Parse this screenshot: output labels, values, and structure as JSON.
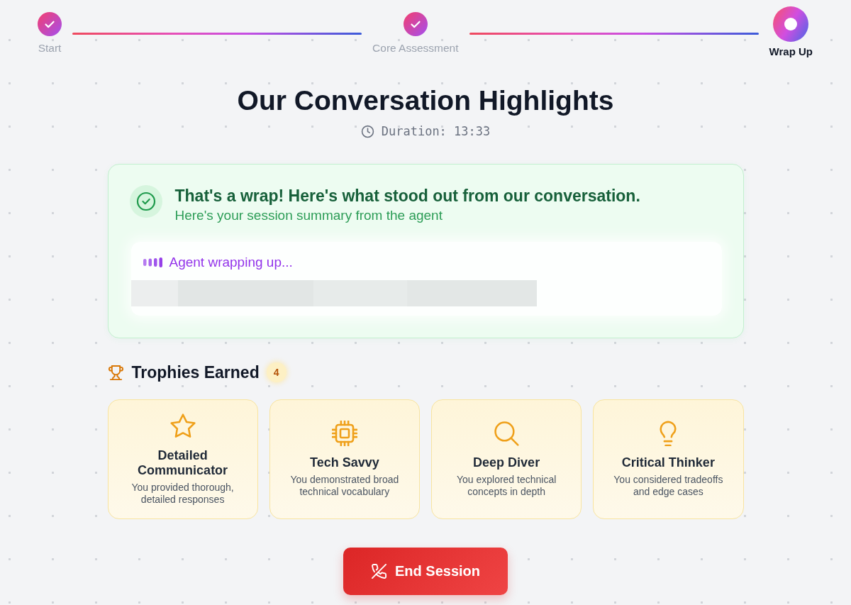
{
  "stepper": {
    "steps": [
      {
        "label": "Start",
        "completed": true,
        "current": false
      },
      {
        "label": "Core Assessment",
        "completed": true,
        "current": false
      },
      {
        "label": "Wrap Up",
        "completed": false,
        "current": true
      }
    ]
  },
  "header": {
    "title": "Our Conversation Highlights",
    "duration": "Duration: 13:33"
  },
  "summary": {
    "heading": "That's a wrap! Here's what stood out from our conversation.",
    "subtitle": "Here's your session summary from the agent",
    "status": "Agent wrapping up...",
    "loading": true
  },
  "trophies": {
    "title": "Trophies Earned",
    "count": "4",
    "items": [
      {
        "title": "Detailed Communicator",
        "description": "You provided thorough, detailed responses"
      },
      {
        "title": "Tech Savvy",
        "description": "You demonstrated broad technical vocabulary"
      },
      {
        "title": "Deep Diver",
        "description": "You explored technical concepts in depth"
      },
      {
        "title": "Critical Thinker",
        "description": "You considered tradeoffs and edge cases"
      }
    ]
  },
  "end_button": {
    "label": "End Session"
  }
}
